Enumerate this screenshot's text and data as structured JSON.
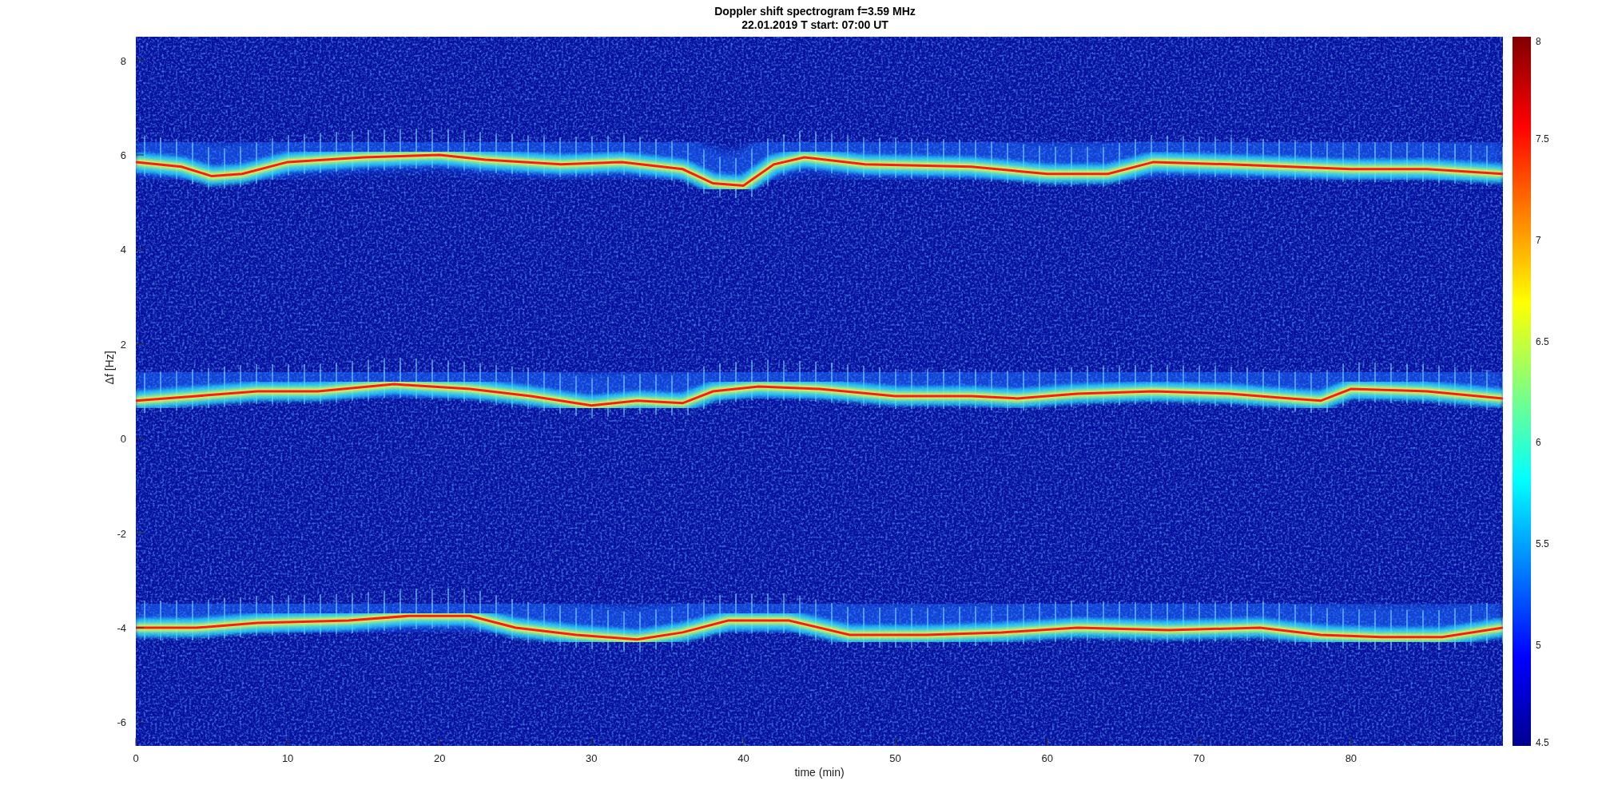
{
  "figure": {
    "title_lines": [
      "Doppler shift spectrogram f=3.59 MHz",
      "22.01.2019   T start: 07:00 UT"
    ],
    "xlabel": "time (min)",
    "ylabel": "Δf [Hz]",
    "xticks": [
      "0",
      "10",
      "20",
      "30",
      "40",
      "50",
      "60",
      "70",
      "80"
    ],
    "yticks": [
      "8",
      "6",
      "4",
      "2",
      "0",
      "-2",
      "-4",
      "-6"
    ],
    "colorbar_ticks": [
      "8",
      "7.5",
      "7",
      "6.5",
      "6",
      "5.5",
      "5",
      "4.5"
    ]
  }
}
